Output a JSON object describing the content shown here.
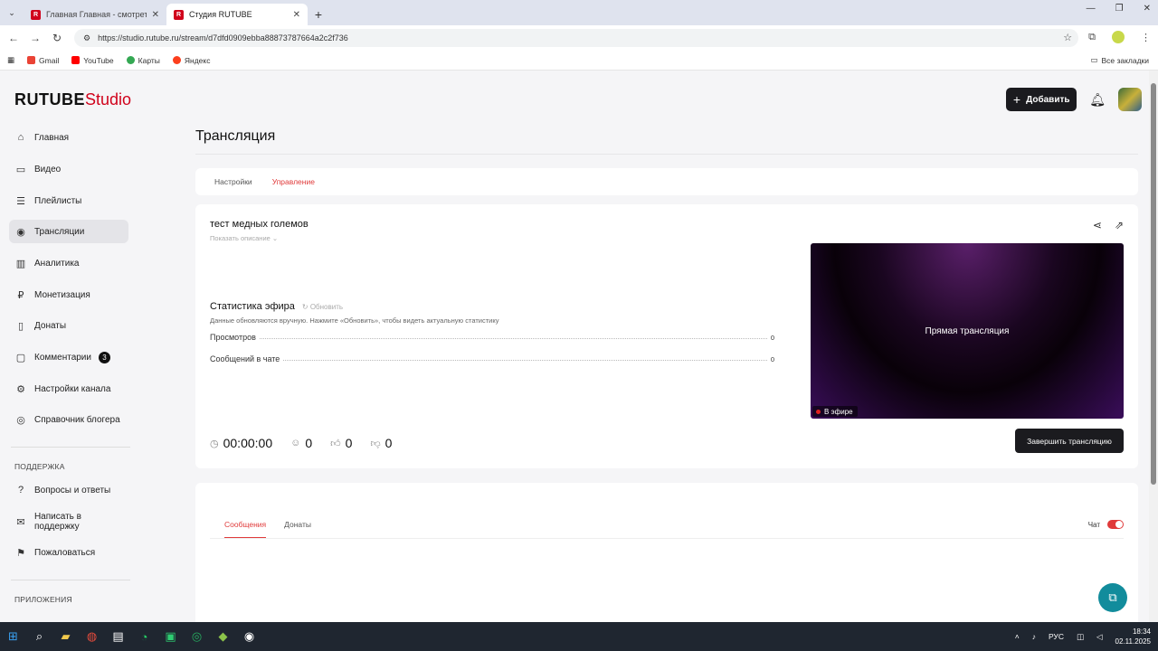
{
  "browser": {
    "tabs": [
      {
        "label": "Главная Главная - смотреть о",
        "active": false
      },
      {
        "label": "Студия RUTUBE",
        "active": true
      }
    ],
    "url": "https://studio.rutube.ru/stream/d7dfd0909ebba88873787664a2c2f736",
    "bookmarks": [
      "Gmail",
      "YouTube",
      "Карты",
      "Яндекс"
    ],
    "all_bookmarks": "Все закладки"
  },
  "app": {
    "logo_main": "RUTUBE",
    "logo_studio": "Studio",
    "add_button": "Добавить",
    "page_title": "Трансляция"
  },
  "sidebar": {
    "items": [
      {
        "label": "Главная",
        "icon": "home-icon"
      },
      {
        "label": "Видео",
        "icon": "video-icon"
      },
      {
        "label": "Плейлисты",
        "icon": "playlist-icon"
      },
      {
        "label": "Трансляции",
        "icon": "broadcast-icon",
        "active": true
      },
      {
        "label": "Аналитика",
        "icon": "analytics-icon"
      },
      {
        "label": "Монетизация",
        "icon": "money-icon"
      },
      {
        "label": "Донаты",
        "icon": "donate-icon"
      },
      {
        "label": "Комментарии",
        "icon": "comments-icon",
        "badge": "3"
      },
      {
        "label": "Настройки канала",
        "icon": "gear-icon"
      },
      {
        "label": "Справочник блогера",
        "icon": "help-book-icon"
      }
    ],
    "support_heading": "ПОДДЕРЖКА",
    "support_items": [
      {
        "label": "Вопросы и ответы",
        "icon": "question-icon"
      },
      {
        "label": "Написать в поддержку",
        "icon": "mail-icon"
      },
      {
        "label": "Пожаловаться",
        "icon": "flag-icon"
      }
    ],
    "apps_heading": "ПРИЛОЖЕНИЯ"
  },
  "stream_tabs": {
    "settings": "Настройки",
    "manage": "Управление"
  },
  "stream": {
    "title": "тест медных големов",
    "show_description": "Показать описание",
    "stats_title": "Статистика эфира",
    "refresh": "Обновить",
    "stats_note": "Данные обновляются вручную. Нажмите «Обновить», чтобы видеть актуальную статистику",
    "stats": [
      {
        "label": "Просмотров",
        "value": "0"
      },
      {
        "label": "Сообщений в чате",
        "value": "0"
      }
    ],
    "timer": "00:00:00",
    "viewers": "0",
    "likes": "0",
    "dislikes": "0",
    "preview_label": "Прямая трансляция",
    "live_badge": "В эфире",
    "end_button": "Завершить трансляцию"
  },
  "chat": {
    "tab_messages": "Сообщения",
    "tab_donates": "Донаты",
    "toggle_label": "Чат",
    "toggle_on": true
  },
  "taskbar": {
    "lang": "РУС",
    "time": "18:34",
    "date": "02.11.2025"
  },
  "colors": {
    "accent": "#e03a3a",
    "brand_red": "#d0021b",
    "dark_button": "#1b1b1f",
    "help_fab": "#128c9c"
  }
}
